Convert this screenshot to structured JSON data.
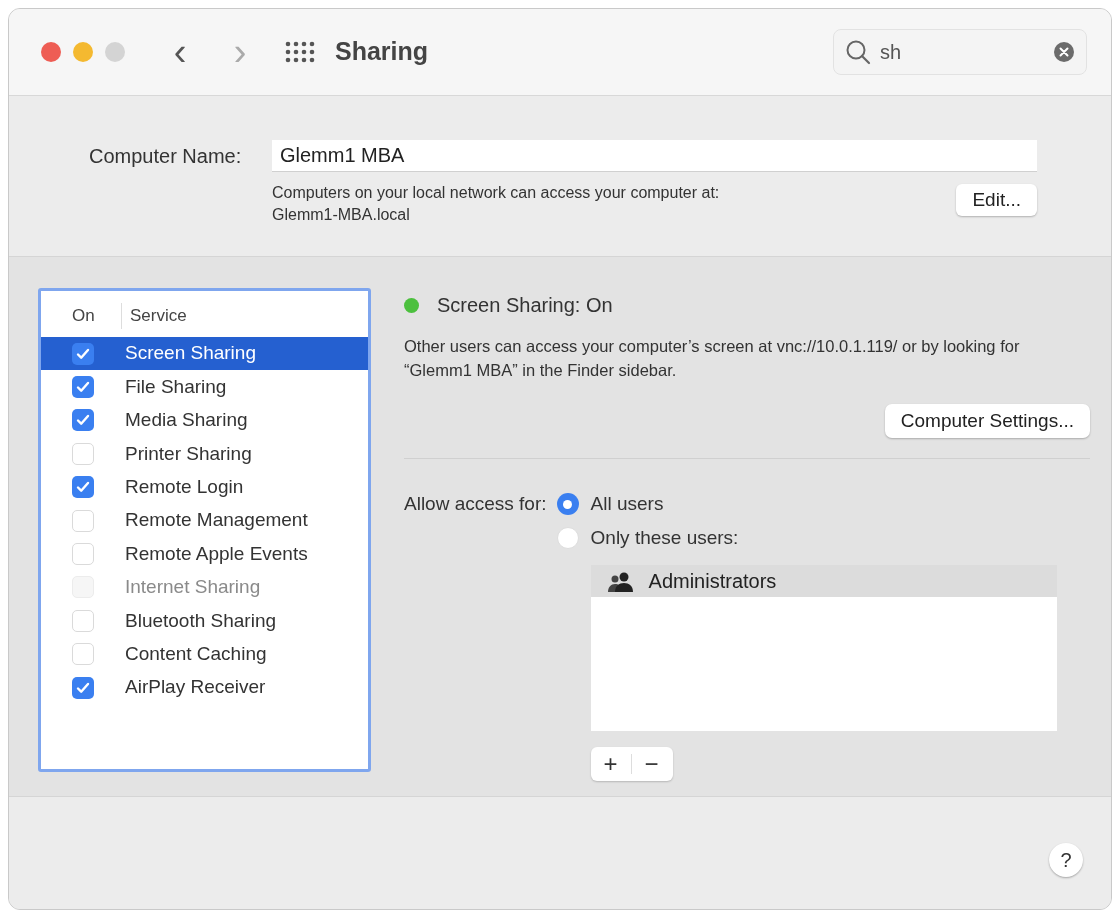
{
  "window": {
    "title": "Sharing",
    "nav": {
      "back": "‹",
      "forward": "›"
    }
  },
  "search": {
    "value": "sh"
  },
  "computer_name": {
    "label": "Computer Name:",
    "value": "Glemm1 MBA",
    "note": "Computers on your local network can access your computer at:",
    "address": "Glemm1-MBA.local",
    "edit_button": "Edit..."
  },
  "services": {
    "columns": [
      "On",
      "Service"
    ],
    "items": [
      {
        "name": "Screen Sharing",
        "checked": true,
        "selected": true,
        "disabled": false
      },
      {
        "name": "File Sharing",
        "checked": true,
        "selected": false,
        "disabled": false
      },
      {
        "name": "Media Sharing",
        "checked": true,
        "selected": false,
        "disabled": false
      },
      {
        "name": "Printer Sharing",
        "checked": false,
        "selected": false,
        "disabled": false
      },
      {
        "name": "Remote Login",
        "checked": true,
        "selected": false,
        "disabled": false
      },
      {
        "name": "Remote Management",
        "checked": false,
        "selected": false,
        "disabled": false
      },
      {
        "name": "Remote Apple Events",
        "checked": false,
        "selected": false,
        "disabled": false
      },
      {
        "name": "Internet Sharing",
        "checked": false,
        "selected": false,
        "disabled": true
      },
      {
        "name": "Bluetooth Sharing",
        "checked": false,
        "selected": false,
        "disabled": false
      },
      {
        "name": "Content Caching",
        "checked": false,
        "selected": false,
        "disabled": false
      },
      {
        "name": "AirPlay Receiver",
        "checked": true,
        "selected": false,
        "disabled": false
      }
    ]
  },
  "detail": {
    "status": {
      "text": "Screen Sharing: On",
      "color": "#4cc03e"
    },
    "description": "Other users can access your computer’s screen at vnc://10.0.1.119/ or by looking for “Glemm1 MBA” in the Finder sidebar.",
    "settings_button": "Computer Settings...",
    "access_label": "Allow access for:",
    "access_options": [
      {
        "label": "All users",
        "selected": true
      },
      {
        "label": "Only these users:",
        "selected": false
      }
    ],
    "users": [
      {
        "name": "Administrators",
        "selected": true
      }
    ],
    "add_button": "+",
    "remove_button": "−"
  },
  "help_button": "?"
}
